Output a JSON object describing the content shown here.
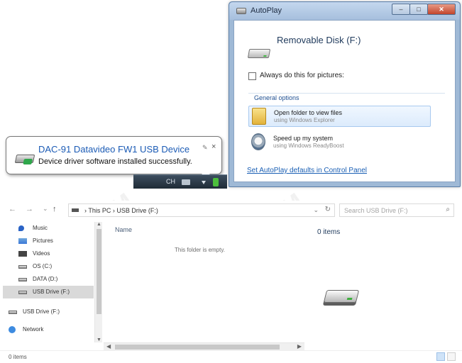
{
  "autoplay": {
    "title": "AutoPlay",
    "heading": "Removable Disk (F:)",
    "always_checkbox_label": "Always do this for pictures:",
    "section_label": "General options",
    "options": [
      {
        "title": "Open folder to view files",
        "subtitle": "using Windows Explorer",
        "icon": "folder-icon",
        "selected": true
      },
      {
        "title": "Speed up my system",
        "subtitle": "using Windows ReadyBoost",
        "icon": "readyboost-icon",
        "selected": false
      }
    ],
    "defaults_link": "Set AutoPlay defaults in Control Panel"
  },
  "notification": {
    "title": "DAC-91 Datavideo FW1 USB Device",
    "message": "Device driver software installed successfully.",
    "close_glyph": "×",
    "pin_glyph": "✎"
  },
  "taskbar": {
    "language": "CH"
  },
  "explorer": {
    "nav": {
      "back": "←",
      "forward": "→",
      "dropdown": "⌄",
      "up": "↑"
    },
    "address_path": "› This PC › USB Drive (F:)",
    "address_dropdown": "⌄",
    "refresh_glyph": "↻",
    "search_placeholder": "Search USB Drive (F:)",
    "search_glyph": "⌕",
    "sidebar": [
      {
        "label": "Music",
        "icon": "music-icon",
        "selected": false
      },
      {
        "label": "Pictures",
        "icon": "pictures-icon",
        "selected": false
      },
      {
        "label": "Videos",
        "icon": "videos-icon",
        "selected": false
      },
      {
        "label": "OS (C:)",
        "icon": "drive-icon",
        "selected": false
      },
      {
        "label": "DATA (D:)",
        "icon": "drive-icon",
        "selected": false
      },
      {
        "label": "USB Drive (F:)",
        "icon": "usb-drive-icon",
        "selected": true
      },
      {
        "label": "USB Drive (F:)",
        "icon": "usb-drive-icon",
        "selected": false
      },
      {
        "label": "Network",
        "icon": "network-icon",
        "selected": false
      }
    ],
    "column_name": "Name",
    "empty_message": "This folder is empty.",
    "preview_items": "0 items",
    "status": "0 items"
  },
  "watermark": "VAITEM"
}
